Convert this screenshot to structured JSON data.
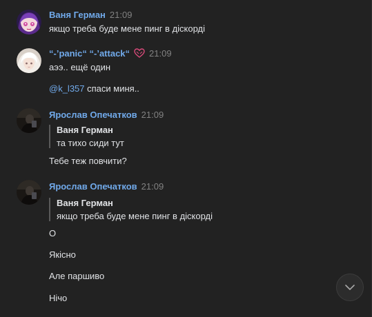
{
  "messages": [
    {
      "author": "Ваня Герман",
      "time": "21:09",
      "avatar": "anime-girl-avatar",
      "lines": [
        "якщо треба буде мене пинг в діскорді"
      ]
    },
    {
      "author": "“-’panic“ “-’attack“",
      "time": "21:09",
      "avatar": "white-hair-avatar",
      "status_emoji": "heart-ribbon-icon",
      "lines": [
        "аээ.. ещё один"
      ],
      "mention_line": {
        "mention": "@k_l357",
        "text": " спаси миня.."
      }
    },
    {
      "author": "Ярослав Опечатков",
      "time": "21:09",
      "avatar": "dark-photo-avatar",
      "quote": {
        "author": "Ваня Герман",
        "text": "та тихо сиди тут"
      },
      "lines": [
        "Тебе теж повчити?"
      ]
    },
    {
      "author": "Ярослав Опечатков",
      "time": "21:09",
      "avatar": "dark-photo-avatar",
      "quote": {
        "author": "Ваня Герман",
        "text": "якщо треба буде мене пинг в діскорді"
      },
      "lines": [
        "О",
        "Якісно",
        "Але паршиво",
        "Нічо"
      ]
    }
  ],
  "colors": {
    "background": "#222222",
    "author": "#71aaeb",
    "text": "#e1e3e6",
    "time": "#828282",
    "quote_bar": "#5a5a5a"
  },
  "icons": {
    "scroll_down": "chevron-down-icon"
  }
}
